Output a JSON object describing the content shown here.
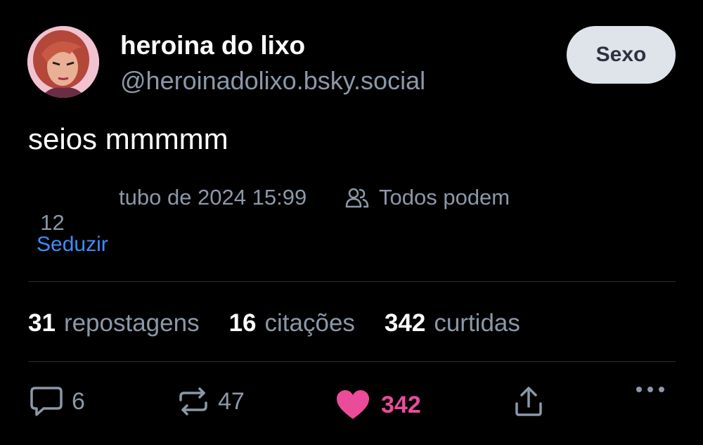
{
  "author": {
    "display_name": "heroina do lixo",
    "handle": "@heroinadolixo.bsky.social"
  },
  "follow_button": {
    "label": "Sexo"
  },
  "post": {
    "text": "seios mmmmm",
    "date_day": "12",
    "date_rest": "tubo de 2024 15:99",
    "privacy": "Todos podem",
    "translate_label": "Seduzir"
  },
  "stats": {
    "reposts_count": "31",
    "reposts_label": "repostagens",
    "quotes_count": "16",
    "quotes_label": "citações",
    "likes_count": "342",
    "likes_label": "curtidas"
  },
  "actions": {
    "reply_count": "6",
    "repost_count": "47",
    "like_count": "342",
    "reply_icon": "comment-bubble-icon",
    "repost_icon": "repost-arrows-icon",
    "like_icon": "heart-icon",
    "share_icon": "share-icon",
    "more_icon": "more-dots-icon"
  },
  "colors": {
    "background": "#000000",
    "muted_text": "#8b98a8",
    "link": "#3f8cf5",
    "like": "#ea4c9a",
    "follow_button_bg": "#dfe4ea"
  }
}
